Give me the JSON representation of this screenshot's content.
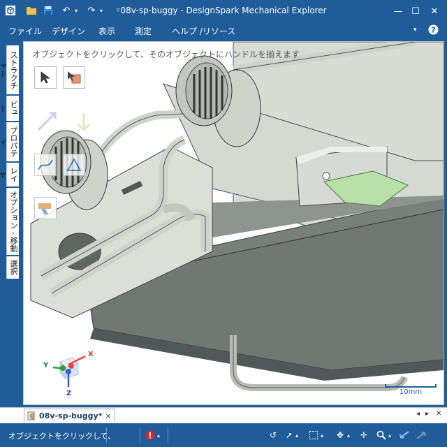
{
  "window": {
    "title": "08v-sp-buggy - DesignSpark Mechanical Explorer"
  },
  "menu": {
    "items": [
      "ファイル",
      "デザイン",
      "表示",
      "測定",
      "ヘルプ /リソース"
    ]
  },
  "side_tabs": [
    "ストラクチャー",
    "ビュー",
    "プロパティ",
    "レイヤ",
    "オプション - 移動",
    "選択"
  ],
  "viewport": {
    "hint": "オブジェクトをクリックして、そのオブジェクトにハンドルを揃えます",
    "scale_label": "10mm",
    "axis_x": "X",
    "axis_y": "Y",
    "axis_z": "Z"
  },
  "document_tab": {
    "label": "08v-sp-buggy*",
    "close": "×"
  },
  "status": {
    "text": "オブジェクトをクリックして、"
  },
  "colors": {
    "chrome": "#1f5c99",
    "accent_green": "#b8e0a8",
    "error_red": "#d9262b"
  }
}
